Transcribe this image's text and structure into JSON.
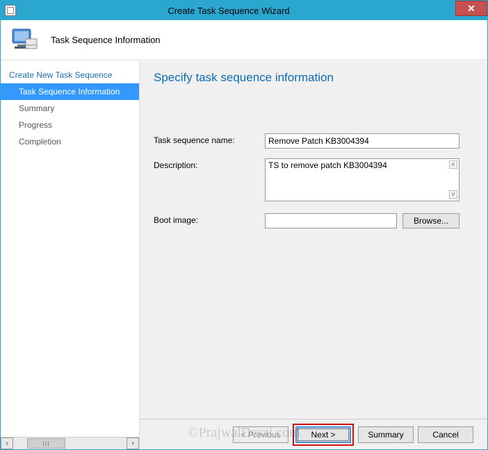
{
  "window": {
    "title": "Create Task Sequence Wizard",
    "close": "✕"
  },
  "header": {
    "subtitle": "Task Sequence Information"
  },
  "sidebar": {
    "items": [
      {
        "label": "Create New Task Sequence",
        "class": "root"
      },
      {
        "label": "Task Sequence Information",
        "class": "child active"
      },
      {
        "label": "Summary",
        "class": "child"
      },
      {
        "label": "Progress",
        "class": "child"
      },
      {
        "label": "Completion",
        "class": "child"
      }
    ],
    "scroll_left": "‹",
    "scroll_right": "›",
    "thumb_grip": "III"
  },
  "page": {
    "title": "Specify task sequence information",
    "name_label": "Task sequence name:",
    "name_value": "Remove Patch KB3004394",
    "desc_label": "Description:",
    "desc_value": "TS to remove patch KB3004394",
    "boot_label": "Boot image:",
    "boot_value": "",
    "browse": "Browse...",
    "up": "˄",
    "down": "˅"
  },
  "footer": {
    "previous": "< Previous",
    "next": "Next >",
    "summary": "Summary",
    "cancel": "Cancel"
  },
  "watermark": "©PrajwalDesai.com"
}
